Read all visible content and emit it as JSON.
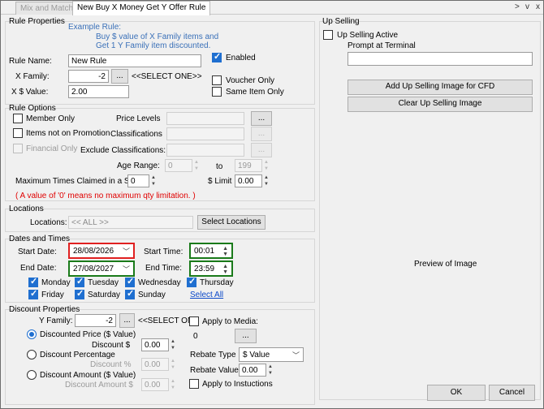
{
  "tabs": {
    "tab1": "Mix and Match",
    "tab2": "New Buy X Money Get Y Offer Rule",
    "nav_next": ">",
    "nav_menu": "v",
    "nav_close": "x"
  },
  "rule_properties": {
    "title": "Rule Properties",
    "example_title": "Example Rule:",
    "example_line1": "Buy $ value of X Family items and",
    "example_line2": "Get 1 Y Family item discounted.",
    "rule_name_label": "Rule Name:",
    "rule_name_value": "New Rule",
    "x_family_label": "X Family:",
    "x_family_value": "-2",
    "x_family_button": "...",
    "x_family_select": "<<SELECT ONE>>",
    "x_value_label": "X $ Value:",
    "x_value_value": "2.00",
    "enabled_label": "Enabled",
    "voucher_only_label": "Voucher Only",
    "same_item_only_label": "Same Item Only"
  },
  "rule_options": {
    "title": "Rule Options",
    "member_only_label": "Member Only",
    "items_not_on_promo_label": "Items not on Promotion",
    "financial_only_label": "Financial Only",
    "price_levels_label": "Price Levels",
    "classifications_label": "Classifications",
    "exclude_classifications_label": "Exclude Classifications:",
    "ellipsis": "...",
    "age_range_label": "Age Range:",
    "age_from": "0",
    "age_to_label": "to",
    "age_to": "199",
    "max_times_label": "Maximum Times Claimed in a Sale:",
    "max_times_value": "0",
    "limit_label": "$ Limit",
    "limit_value": "0.00",
    "note": "( A value of '0' means no maximum qty limitation. )"
  },
  "locations": {
    "title": "Locations",
    "label": "Locations:",
    "value": "<< ALL >>",
    "button": "Select Locations"
  },
  "dates": {
    "title": "Dates and Times",
    "start_date_label": "Start Date:",
    "start_date": "28/08/2026",
    "end_date_label": "End Date:",
    "end_date": "27/08/2027",
    "start_time_label": "Start Time:",
    "start_time": "00:01",
    "end_time_label": "End Time:",
    "end_time": "23:59",
    "days": {
      "monday": "Monday",
      "tuesday": "Tuesday",
      "wednesday": "Wednesday",
      "thursday": "Thursday",
      "friday": "Friday",
      "saturday": "Saturday",
      "sunday": "Sunday"
    },
    "select_all": "Select All"
  },
  "discount": {
    "title": "Discount Properties",
    "y_family_label": "Y Family:",
    "y_family_value": "-2",
    "y_family_button": "...",
    "y_family_select": "<<SELECT ON",
    "discounted_price_label": "Discounted Price ($ Value)",
    "discount_dollar_label": "Discount $",
    "discount_dollar_value": "0.00",
    "discount_percentage_label": "Discount Percentage",
    "discount_pct_label": "Discount %",
    "discount_pct_value": "0.00",
    "discount_amount_label": "Discount Amount ($ Value)",
    "discount_amount_dollar_label": "Discount Amount $",
    "discount_amount_value": "0.00",
    "apply_to_media_label": "Apply to Media:",
    "media_value": "0",
    "media_button": "...",
    "rebate_type_label": "Rebate Type",
    "rebate_type_value": "$ Value",
    "rebate_value_label": "Rebate Value",
    "rebate_value": "0.00",
    "apply_to_instructions_label": "Apply to Instuctions"
  },
  "up_selling": {
    "title": "Up Selling",
    "active_label": "Up Selling Active",
    "prompt_label": "Prompt at Terminal",
    "prompt_value": "",
    "add_image_button": "Add Up Selling Image for CFD",
    "clear_image_button": "Clear Up Selling Image",
    "preview_label": "Preview of Image"
  },
  "footer": {
    "ok": "OK",
    "cancel": "Cancel"
  }
}
